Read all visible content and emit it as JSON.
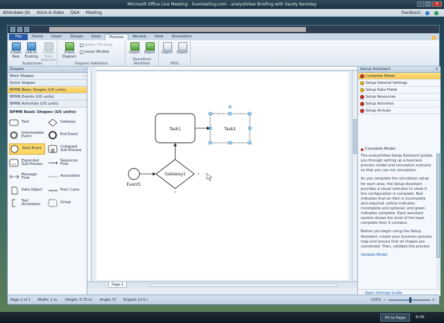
{
  "meeting_window": {
    "title": "Microsoft Office Live Meeting - livemeeting.com - analystView Briefing with Sandy Kemsley",
    "menu": [
      "Attendees (6)",
      "Voice & Video",
      "Q&A",
      "Meeting"
    ],
    "feedback_label": "Feedback:"
  },
  "app": {
    "tabs": [
      "File",
      "Home",
      "Insert",
      "Design",
      "Data",
      "Process",
      "Review",
      "View",
      "Simulation"
    ],
    "active_tab": "Process",
    "ribbon": {
      "subprocess": {
        "group_label": "Subprocess",
        "create_new": "Create New",
        "link_existing": "Link to Existing",
        "create_from_selection": "Create from Selection"
      },
      "diagram_validation": {
        "group_label": "Diagram Validation",
        "check_diagram": "Check Diagram",
        "ignore_issue": "Ignore This Issue",
        "issues_window": "Issues Window"
      },
      "sharepoint_workflow": {
        "group_label": "SharePoint Workflow",
        "import": "Import",
        "export": "Export"
      },
      "xpdl": {
        "group_label": "XPDL",
        "import": "Import",
        "export": "Export"
      }
    },
    "shapes_panel": {
      "title": "Shapes",
      "more_shapes": "More Shapes",
      "stencils": [
        "Quick Shapes",
        "BPMN Basic Shapes (US units)",
        "BPMN Events (US units)",
        "BPMN Activities (US units)"
      ],
      "selected_stencil": "BPMN Basic Shapes (US units)",
      "stencil_heading": "BPMN Basic Shapes (US units)",
      "shapes": [
        "Task",
        "Gateway",
        "Intermediate Event",
        "End Event",
        "Start Event",
        "Collapsed Sub-Process",
        "Expanded Sub-Process",
        "Sequence Flow",
        "Message Flow",
        "Association",
        "Data Object",
        "Pool / Lane",
        "Text Annotation",
        "Group"
      ]
    },
    "diagram": {
      "task1": "Task1",
      "task2": "Task2",
      "gateway": "Gateway1",
      "event": "Event1"
    },
    "page_tab": "Page-1",
    "assistant": {
      "title": "Setup Assistant",
      "items": [
        {
          "label": "Complete Model",
          "status": "error"
        },
        {
          "label": "Setup General Settings",
          "status": "warning"
        },
        {
          "label": "Setup Data Fields",
          "status": "warning"
        },
        {
          "label": "Setup Resources",
          "status": "error"
        },
        {
          "label": "Setup Activities",
          "status": "error"
        },
        {
          "label": "Setup Arrivals",
          "status": "error"
        }
      ],
      "detail_heading": "Complete Model",
      "detail_p1": "The analystView Setup Assistant guides you through setting up a business process model and simulation scenario so that you can run simulation.",
      "detail_p2": "As you complete the simulation setup for each area, the Setup Assistant provides a visual indicator to show if the configuration is complete. Red indicates that an item is incomplete and required; yellow indicates incomplete and optional; and green indicates complete. Each assistant section shows the level of the least complete item it contains.",
      "detail_p3": "Before you begin using the Setup Assistant, create your business process map and ensure that all shapes are connected. Then, validate the process",
      "validate_link": "Validate Model",
      "footer_link": "Open Settings Guide"
    },
    "status": {
      "page": "Page 1 of 1",
      "width": "Width: 1 in.",
      "height": "Height: 0.75 in.",
      "angle": "Angle: 0°",
      "language": "English (U.S.)",
      "zoom": "133%"
    }
  },
  "taskbar": {
    "task": "Fit to Page",
    "clock": "8:06"
  },
  "colors": {
    "accent": "#2c5ba5",
    "selection": "#f8c84e",
    "error": "#d23b2c",
    "warning": "#e8b925"
  }
}
